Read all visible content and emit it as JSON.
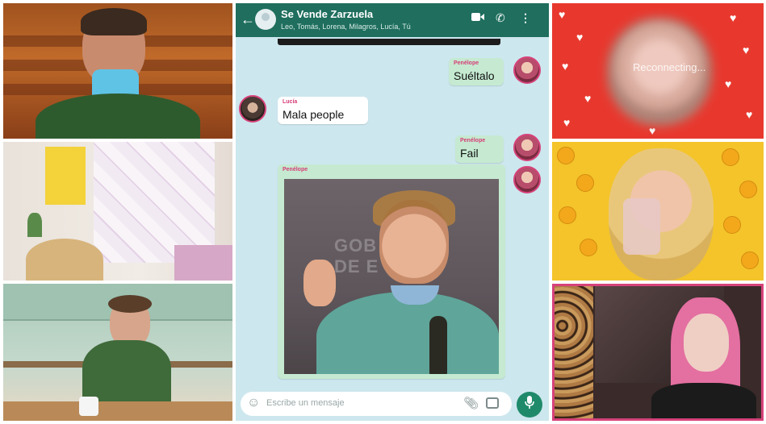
{
  "chat": {
    "header": {
      "title": "Se Vende Zarzuela",
      "members": "Leo, Tomás, Lorena, Milagros, Lucía, Tú"
    },
    "messages": [
      {
        "sender": "Penélope",
        "text": "Suéltalo",
        "direction": "out"
      },
      {
        "sender": "Lucía",
        "text": "Mala people",
        "direction": "in"
      },
      {
        "sender": "Penélope",
        "text": "Fail",
        "direction": "out"
      },
      {
        "sender": "Penélope",
        "text": "",
        "direction": "out",
        "type": "image"
      }
    ],
    "photo_text": [
      "GOB",
      "DE E"
    ],
    "input": {
      "placeholder": "Escribe un mensaje"
    }
  },
  "video_tiles": [
    {
      "name": "auditorium"
    },
    {
      "name": "room"
    },
    {
      "name": "kitchen"
    },
    {
      "name": "hearts-filter",
      "status": "Reconnecting..."
    },
    {
      "name": "emoji-filter"
    },
    {
      "name": "bedroom"
    }
  ],
  "colors": {
    "header": "#1f6e5e",
    "chat_bg": "#cde7ee",
    "outgoing_bubble": "#c5ead1",
    "sender_name": "#d63d76",
    "mic_button": "#1f8a6a"
  },
  "icons": [
    "back-arrow-icon",
    "video-call-icon",
    "phone-icon",
    "more-icon",
    "smile-icon",
    "attach-icon",
    "camera-icon",
    "mic-icon"
  ]
}
